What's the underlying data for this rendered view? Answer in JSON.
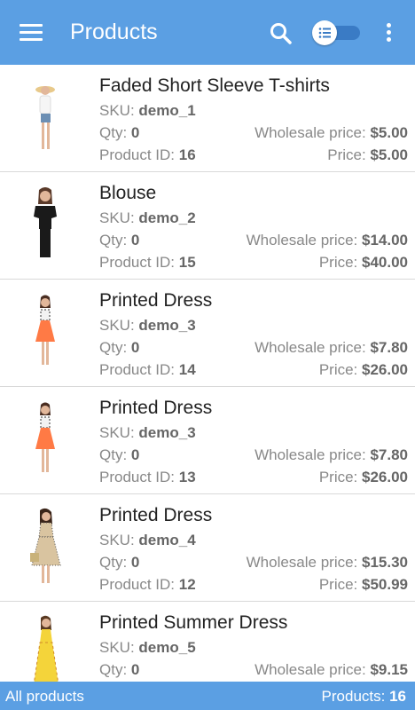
{
  "appbar": {
    "title": "Products",
    "accent": "#5b9fe3"
  },
  "labels": {
    "sku": "SKU: ",
    "qty": "Qty: ",
    "product_id": "Product ID: ",
    "wholesale": "Wholesale price: ",
    "price": "Price: "
  },
  "products": [
    {
      "name": "Faded Short Sleeve T-shirts",
      "sku": "demo_1",
      "qty": "0",
      "id": "16",
      "wholesale": "$5.00",
      "price": "$5.00",
      "image": "woman-tshirt-shorts"
    },
    {
      "name": "Blouse",
      "sku": "demo_2",
      "qty": "0",
      "id": "15",
      "wholesale": "$14.00",
      "price": "$40.00",
      "image": "woman-black-blouse"
    },
    {
      "name": "Printed Dress",
      "sku": "demo_3",
      "qty": "0",
      "id": "14",
      "wholesale": "$7.80",
      "price": "$26.00",
      "image": "woman-orange-dress"
    },
    {
      "name": "Printed Dress",
      "sku": "demo_3",
      "qty": "0",
      "id": "13",
      "wholesale": "$7.80",
      "price": "$26.00",
      "image": "woman-orange-dress"
    },
    {
      "name": "Printed Dress",
      "sku": "demo_4",
      "qty": "0",
      "id": "12",
      "wholesale": "$15.30",
      "price": "$50.99",
      "image": "woman-patterned-dress"
    },
    {
      "name": "Printed Summer Dress",
      "sku": "demo_5",
      "qty": "0",
      "wholesale": "$9.15",
      "image": "woman-yellow-dress"
    }
  ],
  "footer": {
    "left": "All products",
    "count_label": "Products: ",
    "count": "16"
  }
}
